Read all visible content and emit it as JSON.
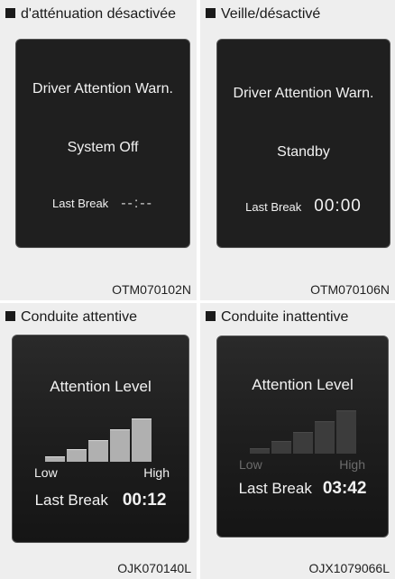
{
  "panels": [
    {
      "caption": "d'atténuation désactivée",
      "screen": {
        "title": "Driver Attention Warn.",
        "status": "System Off",
        "last_break_label": "Last Break",
        "last_break_value": "--:--"
      },
      "code": "OTM070102N"
    },
    {
      "caption": "Veille/désactivé",
      "screen": {
        "title": "Driver Attention Warn.",
        "status": "Standby",
        "last_break_label": "Last Break",
        "last_break_value": "00:00"
      },
      "code": "OTM070106N"
    },
    {
      "caption": "Conduite attentive",
      "screen": {
        "title": "Attention Level",
        "low_label": "Low",
        "high_label": "High",
        "level": 5,
        "level_max": 5,
        "last_break_label": "Last Break",
        "last_break_value": "00:12"
      },
      "code": "OJK070140L"
    },
    {
      "caption": "Conduite inattentive",
      "screen": {
        "title": "Attention Level",
        "low_label": "Low",
        "high_label": "High",
        "level": 0,
        "level_max": 5,
        "last_break_label": "Last Break",
        "last_break_value": "03:42"
      },
      "code": "OJX1079066L"
    }
  ],
  "colors": {
    "screen_bg": "#1f1f1f",
    "bar_active": "#b0b0b0",
    "bar_inactive": "#3c3c3c",
    "panel_bg": "#eeeeee"
  }
}
